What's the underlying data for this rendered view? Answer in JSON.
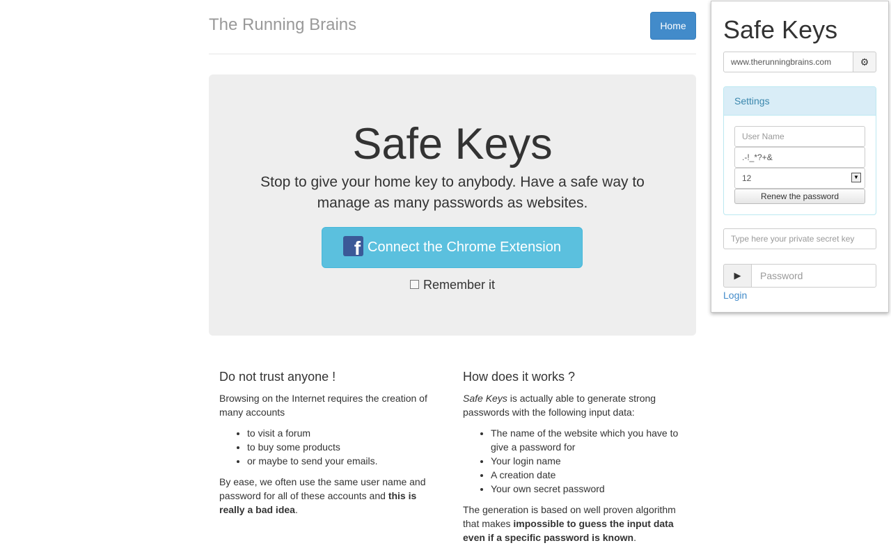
{
  "header": {
    "brand": "The Running Brains",
    "home_label": "Home"
  },
  "jumbotron": {
    "title": "Safe Keys",
    "lead": "Stop to give your home key to anybody. Have a safe way to manage as many passwords as websites.",
    "connect_label": "Connect the Chrome Extension",
    "remember_label": "Remember it"
  },
  "left_column": {
    "heading": "Do not trust anyone !",
    "intro": "Browsing on the Internet requires the creation of many accounts",
    "items": [
      "to visit a forum",
      "to buy some products",
      "or maybe to send your emails."
    ],
    "outro_start": "By ease, we often use the same user name and password for all of these accounts and ",
    "outro_bold": "this is really a bad idea",
    "outro_end": "."
  },
  "right_column": {
    "heading": "How does it works ?",
    "intro_em": "Safe Keys",
    "intro_rest": " is actually able to generate strong passwords with the following input data:",
    "items": [
      "The name of the website which you have to give a password for",
      "Your login name",
      "A creation date",
      "Your own secret password"
    ],
    "outro_start": "The generation is based on well proven algorithm that makes ",
    "outro_bold": "impossible to guess the input data even if a specific password is known",
    "outro_end": "."
  },
  "popup": {
    "title": "Safe Keys",
    "url_value": "www.therunningbrains.com",
    "gear_icon": "gear-icon",
    "settings": {
      "heading": "Settings",
      "username_placeholder": "User Name",
      "chars_value": ".-!_*?+&",
      "length_value": "12",
      "renew_label": "Renew the password"
    },
    "secret_placeholder": "Type here your private secret key",
    "play_icon": "play-icon",
    "password_placeholder": "Password",
    "login_label": "Login"
  },
  "colors": {
    "primary": "#428bca",
    "info": "#5bc0de",
    "facebook": "#3b5998",
    "panel_head": "#d9edf7"
  }
}
